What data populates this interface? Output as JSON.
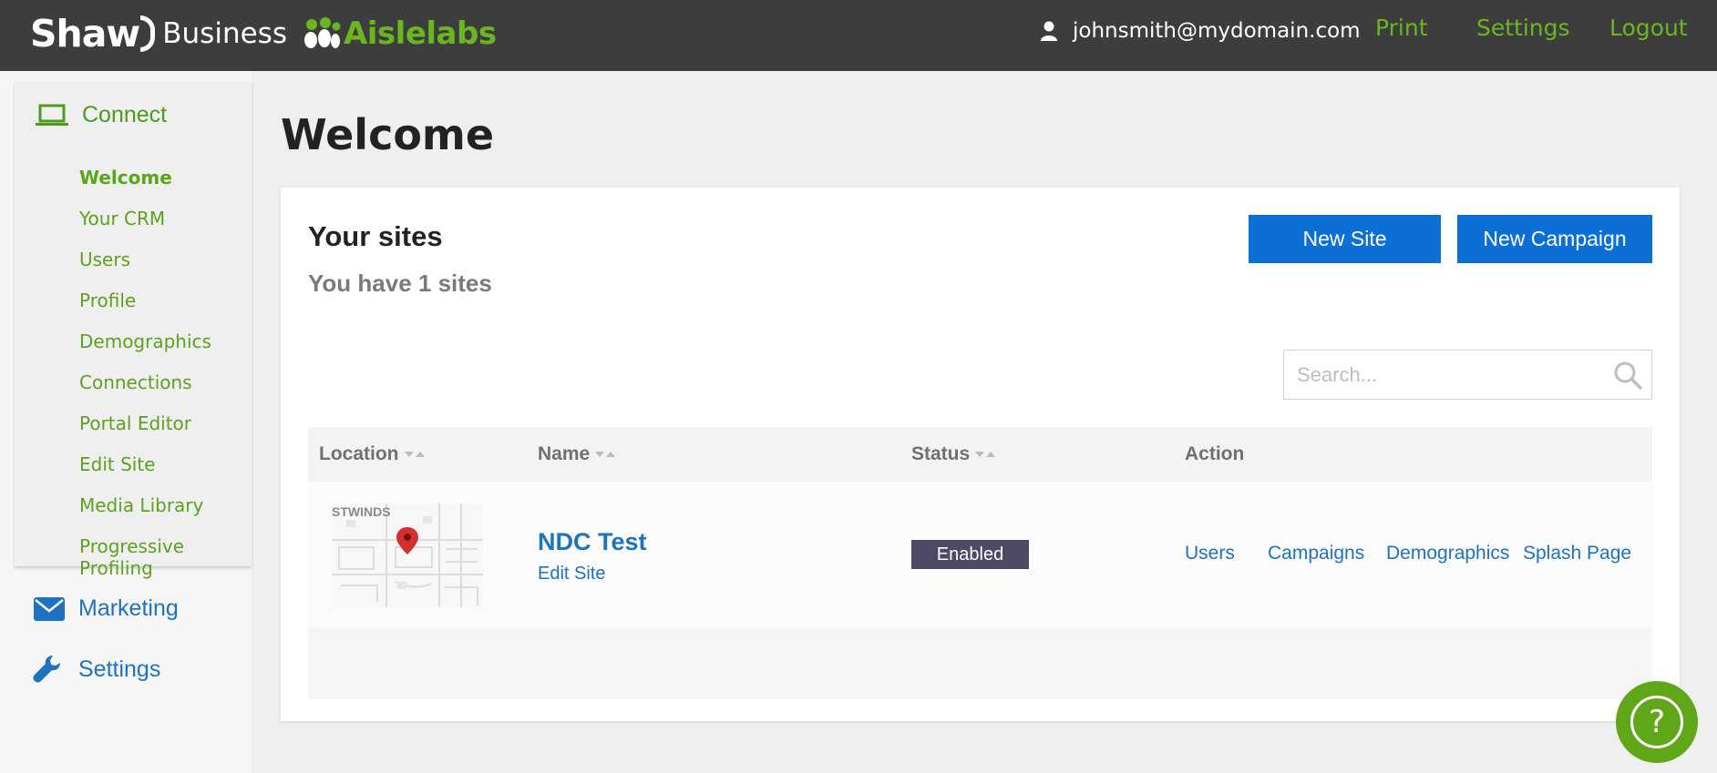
{
  "header": {
    "brand_primary": "Shaw",
    "brand_secondary": "Business",
    "partner_brand": "Aislelabs",
    "user_email": "johnsmith@mydomain.com",
    "nav": {
      "print": "Print",
      "settings": "Settings",
      "logout": "Logout"
    }
  },
  "sidebar": {
    "connect": {
      "label": "Connect",
      "icon": "laptop-icon",
      "items": [
        {
          "label": "Welcome",
          "active": true
        },
        {
          "label": "Your CRM"
        },
        {
          "label": "Users"
        },
        {
          "label": "Profile"
        },
        {
          "label": "Demographics"
        },
        {
          "label": "Connections"
        },
        {
          "label": "Portal Editor"
        },
        {
          "label": "Edit Site"
        },
        {
          "label": "Media Library"
        },
        {
          "label": "Progressive Profiling"
        }
      ]
    },
    "marketing": {
      "label": "Marketing",
      "icon": "envelope-icon"
    },
    "settings": {
      "label": "Settings",
      "icon": "wrench-icon"
    }
  },
  "main": {
    "title": "Welcome",
    "sites_title": "Your sites",
    "sites_count": "You have 1 sites",
    "buttons": {
      "new_site": "New Site",
      "new_campaign": "New Campaign"
    },
    "search": {
      "placeholder": "Search...",
      "value": ""
    },
    "table": {
      "columns": {
        "location": "Location",
        "name": "Name",
        "status": "Status",
        "action": "Action"
      },
      "rows": [
        {
          "map_label": "STWINDS",
          "name": "NDC Test",
          "edit_link": "Edit Site",
          "status": "Enabled",
          "actions": {
            "users": "Users",
            "campaigns": "Campaigns",
            "demographics": "Demographics",
            "splash": "Splash Page"
          }
        }
      ]
    }
  },
  "colors": {
    "topbar": "#3d3d3d",
    "accent_green": "#6bb620",
    "link_blue": "#1e73be",
    "button_blue": "#0b6fd6",
    "status_badge": "#4c4a64",
    "help_button": "#5fa618"
  },
  "help": {
    "label": "?",
    "icon": "help-icon"
  }
}
